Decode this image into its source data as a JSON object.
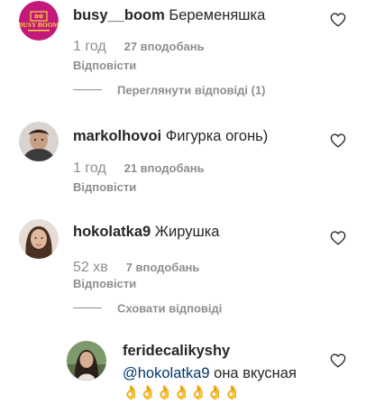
{
  "comments": [
    {
      "username": "busy__boom",
      "text": "Беременяшка",
      "avatar_text": "BUSY BOOM",
      "time": "1 год",
      "likes": "27 вподобань",
      "reply_label": "Відповісти",
      "thread_toggle": "Переглянути відповіді (1)"
    },
    {
      "username": "markolhovoi",
      "text": "Фигурка огонь)",
      "time": "1 год",
      "likes": "21 вподобань",
      "reply_label": "Відповісти"
    },
    {
      "username": "hokolatka9",
      "text": "Жирушка",
      "time": "52 хв",
      "likes": "7 вподобань",
      "reply_label": "Відповісти",
      "thread_toggle": "Сховати відповіді"
    }
  ],
  "reply": {
    "username": "feridecalikyshy",
    "mention": "@hokolatka9",
    "text": " она вкусная",
    "emojis": "👌👌👌👌👌👌👌"
  },
  "colors": {
    "brand_avatar": "#c2197a",
    "brand_text": "#f5d23a",
    "secondary_text": "#8e8e8e",
    "mention": "#00376b"
  }
}
